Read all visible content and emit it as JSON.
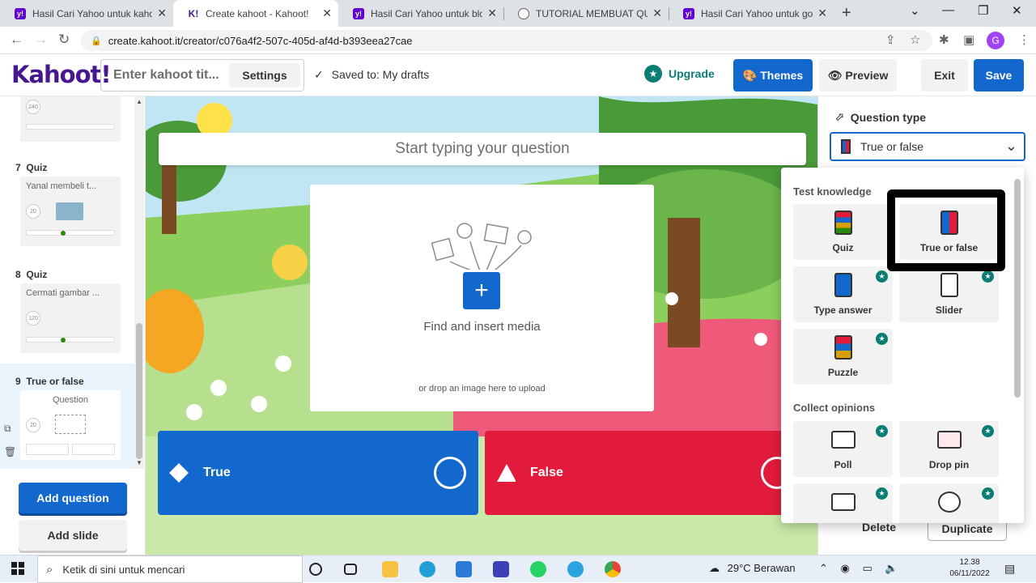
{
  "browser": {
    "tabs": [
      {
        "title": "Hasil Cari Yahoo untuk kahoot",
        "favicon": "yahoo-icon"
      },
      {
        "title": "Create kahoot - Kahoot!",
        "favicon": "kahoot-icon"
      },
      {
        "title": "Hasil Cari Yahoo untuk blog",
        "favicon": "yahoo-icon"
      },
      {
        "title": "TUTORIAL MEMBUAT QUIS C",
        "favicon": "globe-icon"
      },
      {
        "title": "Hasil Cari Yahoo untuk goog",
        "favicon": "yahoo-icon"
      }
    ],
    "url": "create.kahoot.it/creator/c076a4f2-507c-405d-af4d-b393eea27cae",
    "profile_initial": "G"
  },
  "header": {
    "logo": "Kahoot!",
    "title_placeholder": "Enter kahoot tit...",
    "settings_label": "Settings",
    "saved_text": "Saved to: My drafts",
    "upgrade_label": "Upgrade",
    "themes_label": "Themes",
    "preview_label": "Preview",
    "exit_label": "Exit",
    "save_label": "Save"
  },
  "sidebar": {
    "slides": [
      {
        "number": "7",
        "type": "Quiz",
        "thumb_text": "Yanal membeli t...",
        "time": "20"
      },
      {
        "number": "8",
        "type": "Quiz",
        "thumb_text": "Cermati gambar ...",
        "time": "120"
      },
      {
        "number": "9",
        "type": "True or false",
        "thumb_text": "Question",
        "time": "20"
      }
    ],
    "top_partial_time": "240",
    "add_question_label": "Add question",
    "add_slide_label": "Add slide"
  },
  "canvas": {
    "question_placeholder": "Start typing your question",
    "find_media": "Find and insert media",
    "drop_text": "or drop an image here to upload",
    "answers": [
      {
        "label": "True",
        "color": "#1368ce",
        "shape": "diamond"
      },
      {
        "label": "False",
        "color": "#e21b3c",
        "shape": "triangle"
      }
    ]
  },
  "right_panel": {
    "question_type_heading": "Question type",
    "selected_type": "True or false",
    "delete_label": "Delete",
    "duplicate_label": "Duplicate"
  },
  "dropdown": {
    "section_test": "Test knowledge",
    "section_collect": "Collect opinions",
    "test_items": [
      {
        "label": "Quiz",
        "premium": false
      },
      {
        "label": "True or false",
        "premium": false
      },
      {
        "label": "Type answer",
        "premium": true
      },
      {
        "label": "Slider",
        "premium": true
      },
      {
        "label": "Puzzle",
        "premium": true
      }
    ],
    "collect_items": [
      {
        "label": "Poll",
        "premium": true
      },
      {
        "label": "Drop pin",
        "premium": true
      },
      {
        "label": "",
        "premium": true
      },
      {
        "label": "",
        "premium": true
      }
    ]
  },
  "taskbar": {
    "search_placeholder": "Ketik di sini untuk mencari",
    "weather": "29°C  Berawan",
    "time": "12.38",
    "date": "06/11/2022"
  },
  "colors": {
    "kahoot_purple": "#46178f",
    "blue": "#1368ce",
    "red": "#e21b3c",
    "teal": "#0a7d74"
  }
}
